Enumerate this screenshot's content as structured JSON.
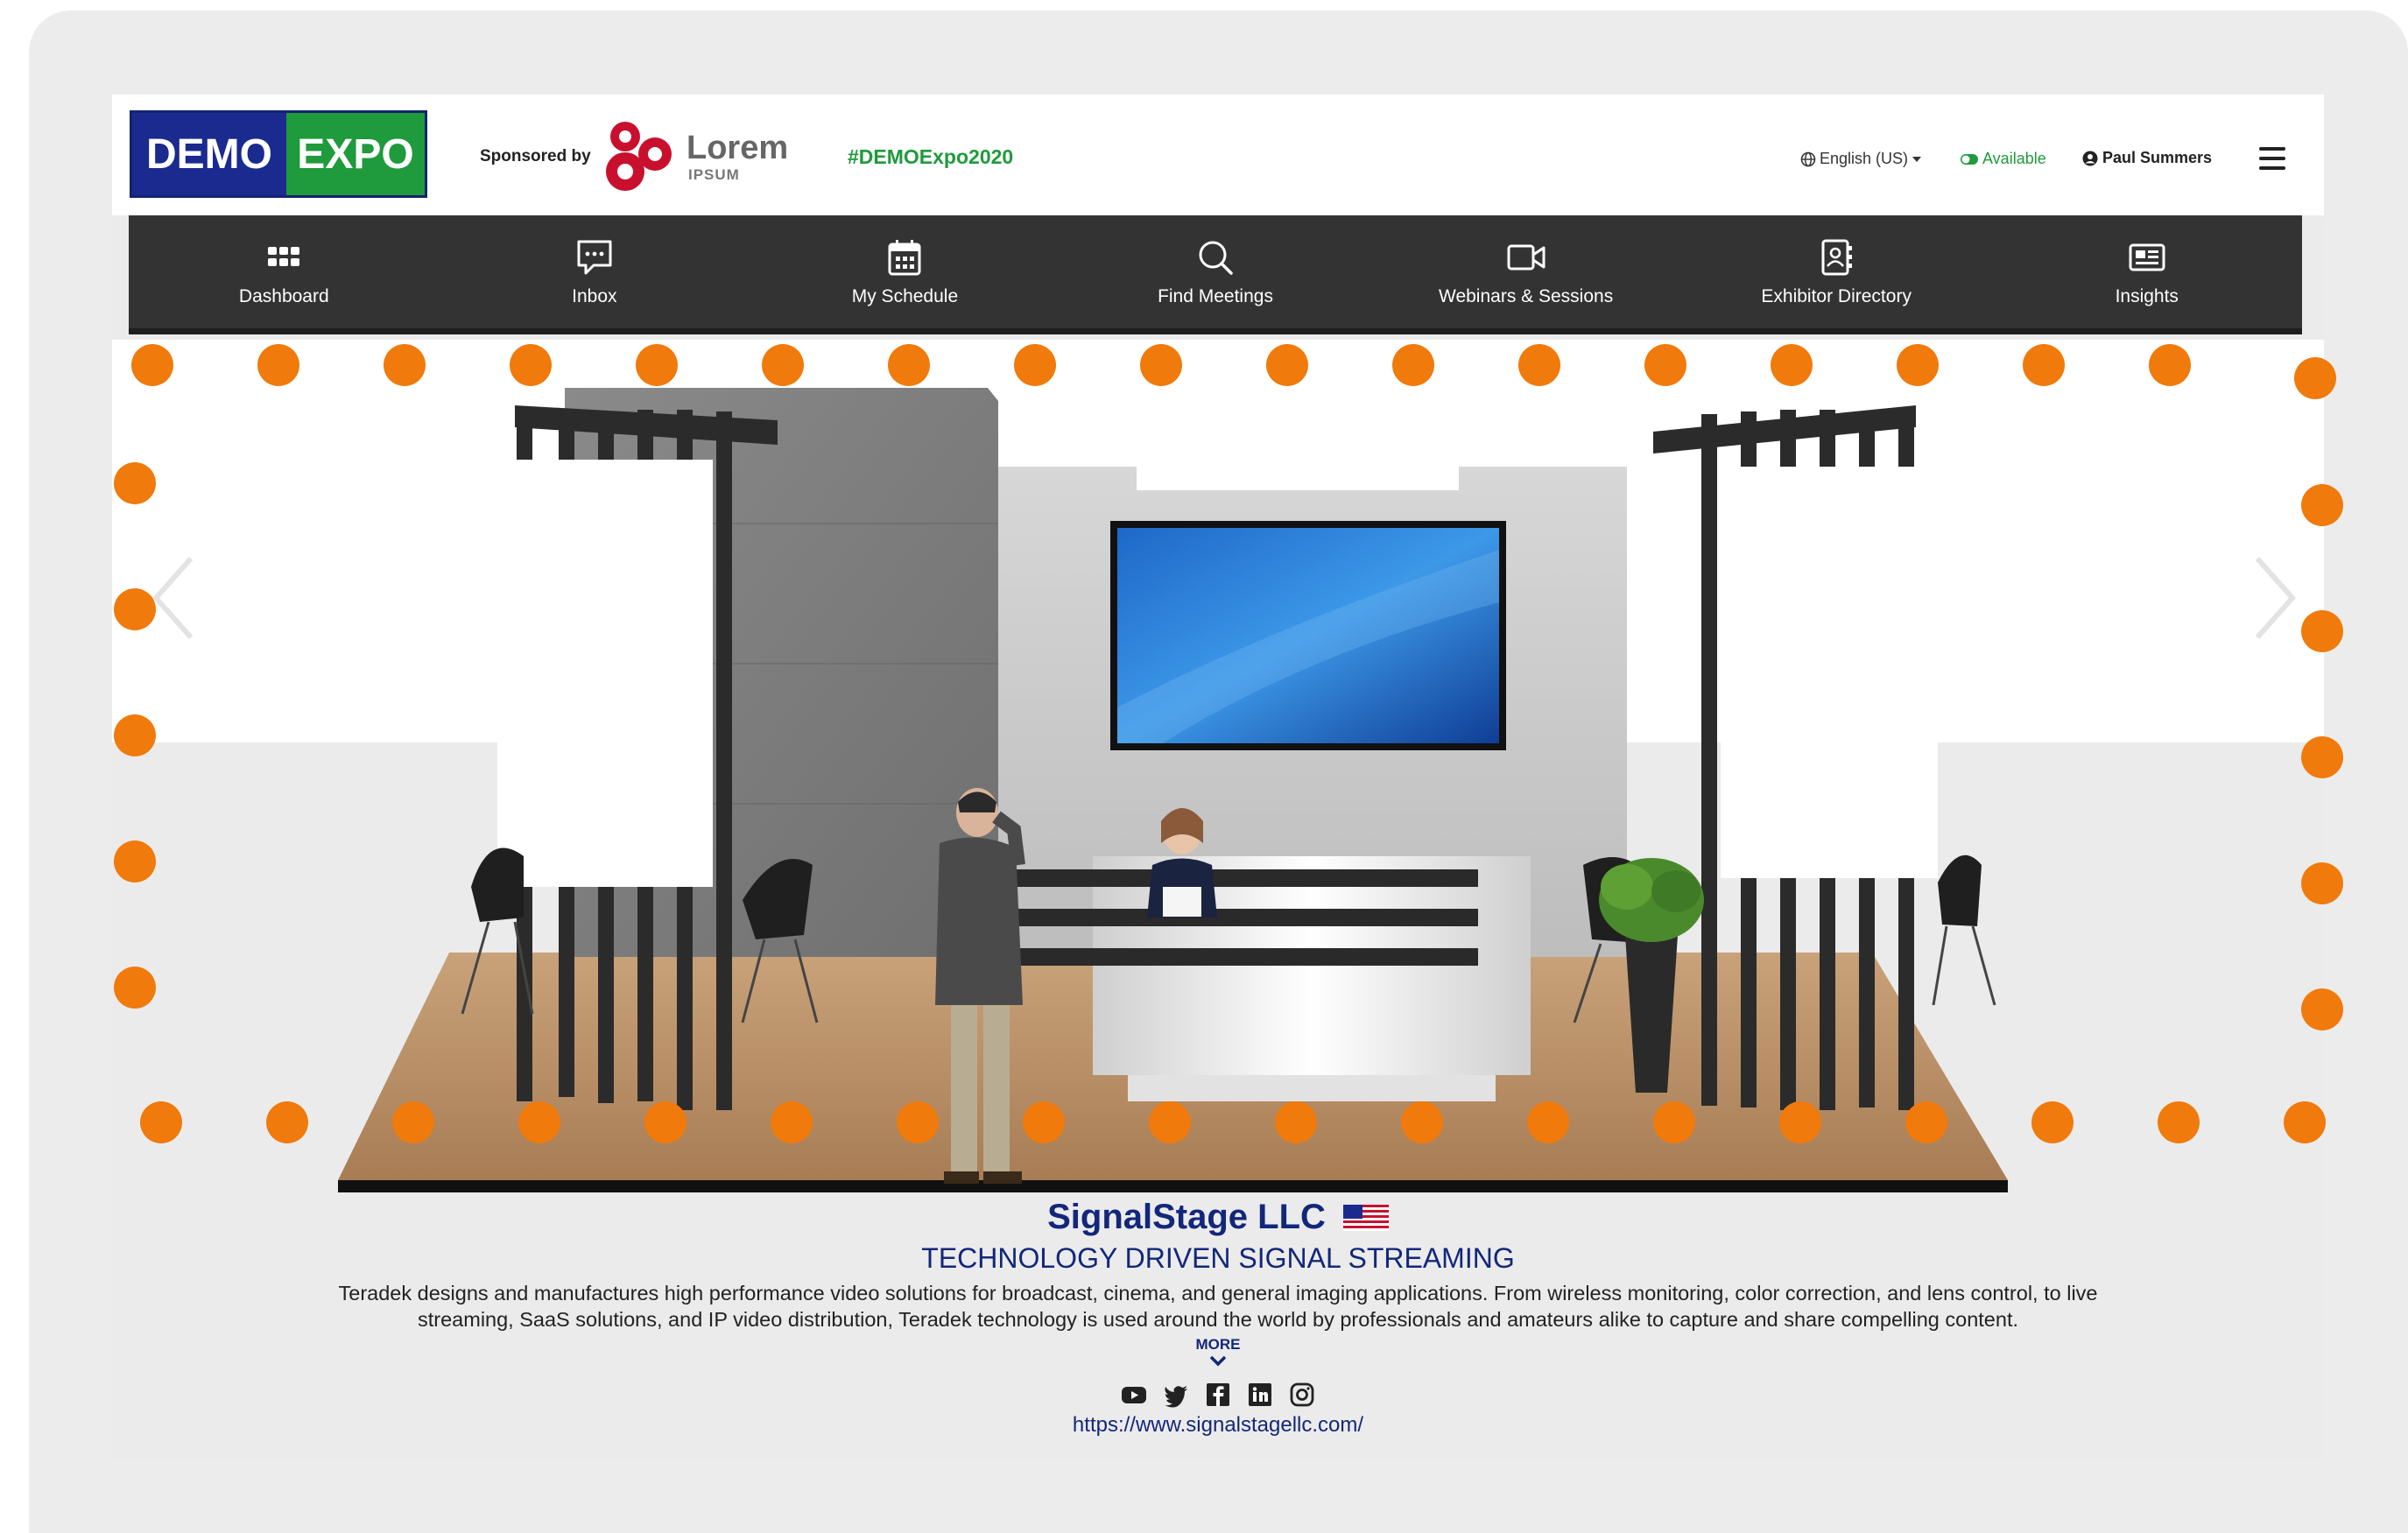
{
  "header": {
    "logo_left": "DEMO",
    "logo_right": "EXPO",
    "sponsored_label": "Sponsored by",
    "sponsor_name": "Lorem",
    "sponsor_sub": "IPSUM",
    "hashtag": "#DEMOExpo2020",
    "language": "English (US)",
    "status": "Available",
    "user_name": "Paul Summers"
  },
  "nav": {
    "items": [
      {
        "label": "Dashboard",
        "icon": "grid-icon"
      },
      {
        "label": "Inbox",
        "icon": "chat-icon"
      },
      {
        "label": "My Schedule",
        "icon": "calendar-icon"
      },
      {
        "label": "Find Meetings",
        "icon": "search-icon"
      },
      {
        "label": "Webinars & Sessions",
        "icon": "video-icon"
      },
      {
        "label": "Exhibitor Directory",
        "icon": "contact-book-icon"
      },
      {
        "label": "Insights",
        "icon": "newspaper-icon"
      }
    ]
  },
  "booth": {
    "accent_color": "#f07a0b"
  },
  "exhibitor": {
    "name": "SignalStage LLC",
    "tagline": "TECHNOLOGY DRIVEN SIGNAL STREAMING",
    "description": "Teradek designs and manufactures high performance video solutions for broadcast, cinema, and general imaging applications. From wireless monitoring, color correction, and lens control, to live streaming, SaaS solutions, and IP video distribution, Teradek technology is used around the world by professionals and amateurs alike to capture and share compelling content.",
    "more_label": "MORE",
    "social": [
      "youtube-icon",
      "twitter-icon",
      "facebook-icon",
      "linkedin-icon",
      "instagram-icon"
    ],
    "url": "https://www.signalstagellc.com/"
  },
  "colors": {
    "brand_blue": "#13277a",
    "brand_green": "#1f9a3c",
    "nav_bg": "#333333"
  }
}
